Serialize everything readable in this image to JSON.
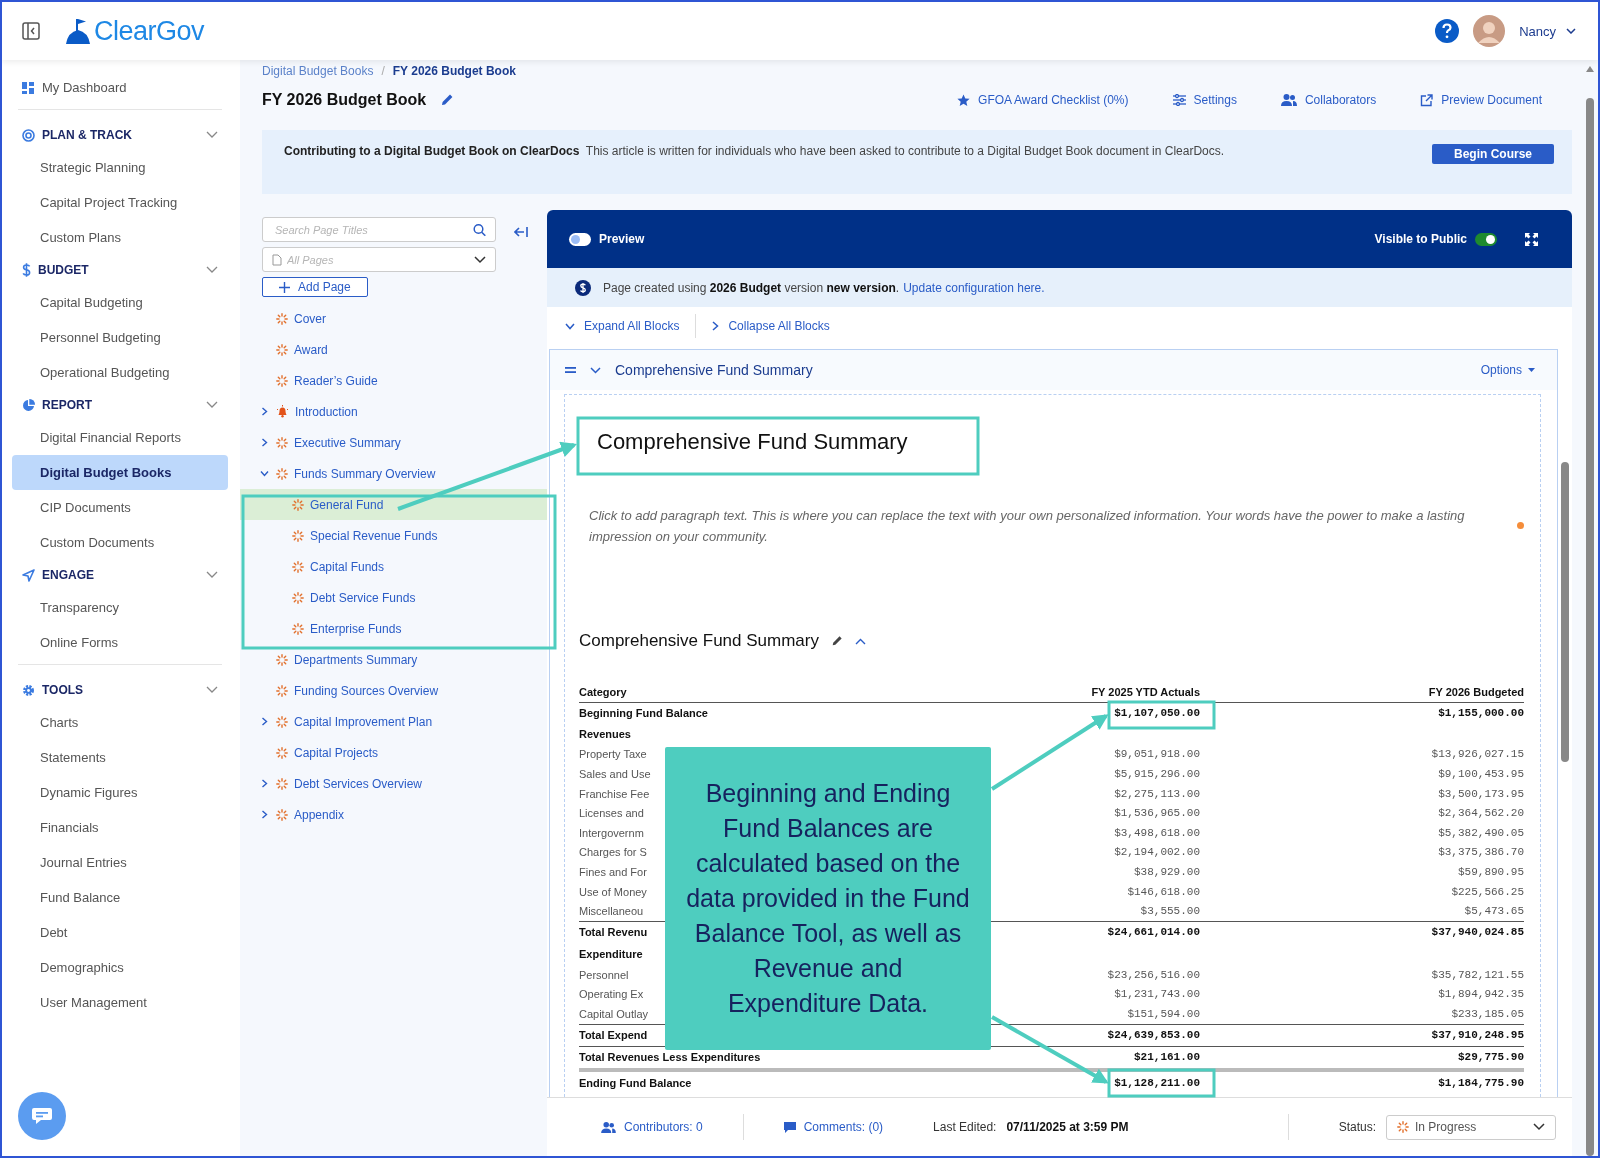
{
  "header": {
    "logo": "ClearGov",
    "user": "Nancy"
  },
  "sidebar": {
    "dashboard": "My Dashboard",
    "groups": [
      {
        "sections": [
          {
            "title": "PLAN & TRACK",
            "kind": "plan",
            "expanded": true,
            "items": [
              {
                "label": "Strategic Planning",
                "selected": false
              },
              {
                "label": "Capital Project Tracking",
                "selected": false
              },
              {
                "label": "Custom Plans",
                "selected": false
              }
            ]
          },
          {
            "title": "BUDGET",
            "kind": "budget",
            "expanded": true,
            "items": [
              {
                "label": "Capital Budgeting",
                "selected": false
              },
              {
                "label": "Personnel Budgeting",
                "selected": false
              },
              {
                "label": "Operational Budgeting",
                "selected": false
              }
            ]
          },
          {
            "title": "REPORT",
            "kind": "report",
            "expanded": true,
            "items": [
              {
                "label": "Digital Financial Reports",
                "selected": false
              },
              {
                "label": "Digital Budget Books",
                "selected": true
              },
              {
                "label": "CIP Documents",
                "selected": false
              },
              {
                "label": "Custom Documents",
                "selected": false
              }
            ]
          },
          {
            "title": "ENGAGE",
            "kind": "engage",
            "expanded": true,
            "items": [
              {
                "label": "Transparency",
                "selected": false
              },
              {
                "label": "Online Forms",
                "selected": false
              }
            ]
          }
        ]
      },
      {
        "sections": [
          {
            "title": "TOOLS",
            "kind": "tools",
            "expanded": true,
            "items": [
              {
                "label": "Charts",
                "selected": false
              },
              {
                "label": "Statements",
                "selected": false
              },
              {
                "label": "Dynamic Figures",
                "selected": false
              },
              {
                "label": "Financials",
                "selected": false
              },
              {
                "label": "Journal Entries",
                "selected": false
              },
              {
                "label": "Fund Balance",
                "selected": false
              },
              {
                "label": "Debt",
                "selected": false
              },
              {
                "label": "Demographics",
                "selected": false
              },
              {
                "label": "User Management",
                "selected": false
              }
            ]
          }
        ]
      }
    ]
  },
  "breadcrumb": {
    "items": [
      "Digital Budget Books",
      "FY 2026 Budget Book"
    ],
    "separator": "/"
  },
  "title": "FY 2026 Budget Book",
  "actions": [
    {
      "label": "GFOA Award Checklist (0%)",
      "kind": "star"
    },
    {
      "label": "Settings",
      "kind": "sliders"
    },
    {
      "label": "Collaborators",
      "kind": "people"
    },
    {
      "label": "Preview Document",
      "kind": "external"
    }
  ],
  "banner": {
    "title": "Contributing to a Digital Budget Book on ClearDocs",
    "text": "This article is written for individuals who have been asked to contribute to a Digital Budget Book document in ClearDocs.",
    "button": "Begin Course"
  },
  "pages": {
    "search": {
      "placeholder": "Search Page Titles"
    },
    "filter": {
      "placeholder": "All Pages"
    },
    "add_button": "Add Page",
    "items": [
      {
        "label": "Cover",
        "alert": false,
        "selected": false
      },
      {
        "label": "Award",
        "alert": false,
        "selected": false
      },
      {
        "label": "Reader’s Guide",
        "alert": false,
        "selected": false
      },
      {
        "label": "Introduction",
        "alert": true,
        "expanded": false,
        "selected": false
      },
      {
        "label": "Executive Summary",
        "alert": false,
        "expanded": false,
        "selected": false
      },
      {
        "label": "Funds Summary Overview",
        "alert": false,
        "expanded": true,
        "selected": false,
        "children": [
          {
            "label": "General Fund",
            "alert": false,
            "selected": true
          },
          {
            "label": "Special Revenue Funds",
            "alert": false,
            "selected": false
          },
          {
            "label": "Capital Funds",
            "alert": false,
            "selected": false
          },
          {
            "label": "Debt Service Funds",
            "alert": false,
            "selected": false
          },
          {
            "label": "Enterprise Funds",
            "alert": false,
            "selected": false
          }
        ]
      },
      {
        "label": "Departments Summary",
        "alert": false,
        "selected": false
      },
      {
        "label": "Funding Sources Overview",
        "alert": false,
        "selected": false
      },
      {
        "label": "Capital Improvement Plan",
        "alert": false,
        "expanded": false,
        "selected": false
      },
      {
        "label": "Capital Projects",
        "alert": false,
        "selected": false
      },
      {
        "label": "Debt Services Overview",
        "alert": false,
        "expanded": false,
        "selected": false
      },
      {
        "label": "Appendix",
        "alert": false,
        "expanded": false,
        "selected": false
      }
    ]
  },
  "editor": {
    "preview": {
      "label": "Preview",
      "on": false
    },
    "visible": {
      "label": "Visible to Public",
      "on": true
    },
    "info": "Page created using **2026 Budget** version **new version**.",
    "info_link": "Update configuration here.",
    "expand_all": "Expand All Blocks",
    "collapse_all": "Collapse All Blocks",
    "block": {
      "title": "Comprehensive Fund Summary",
      "options": "Options",
      "heading": "Comprehensive Fund Summary",
      "paragraph": "Click to add paragraph text. This is where you can replace the text with your own personalized information. Your words have the power to make a lasting impression on your community.",
      "table_title": "Comprehensive Fund Summary",
      "table": {
        "columns": [
          "Category",
          "FY 2025 YTD Actuals",
          "FY 2026 Budgeted"
        ],
        "rows": [
          {
            "kind": "balance",
            "cells": [
              "Beginning Fund Balance",
              "$1,107,050.00",
              "$1,155,000.00"
            ]
          },
          {
            "kind": "section",
            "cells": [
              "Revenues"
            ]
          },
          {
            "kind": "line",
            "cells": [
              "Property Taxe",
              "$9,051,918.00",
              "$13,926,027.15"
            ]
          },
          {
            "kind": "line",
            "cells": [
              "Sales and Use",
              "$5,915,296.00",
              "$9,100,453.95"
            ]
          },
          {
            "kind": "line",
            "cells": [
              "Franchise Fee",
              "$2,275,113.00",
              "$3,500,173.95"
            ]
          },
          {
            "kind": "line",
            "cells": [
              "Licenses and",
              "$1,536,965.00",
              "$2,364,562.20"
            ]
          },
          {
            "kind": "line",
            "cells": [
              "Intergovernm",
              "$3,498,618.00",
              "$5,382,490.05"
            ]
          },
          {
            "kind": "line",
            "cells": [
              "Charges for S",
              "$2,194,002.00",
              "$3,375,386.70"
            ]
          },
          {
            "kind": "line",
            "cells": [
              "Fines and For",
              "$38,929.00",
              "$59,890.95"
            ]
          },
          {
            "kind": "line",
            "cells": [
              "Use of Money",
              "$146,618.00",
              "$225,566.25"
            ]
          },
          {
            "kind": "line",
            "cells": [
              "Miscellaneou",
              "$3,555.00",
              "$5,473.65"
            ]
          },
          {
            "kind": "total",
            "cells": [
              "Total Revenu",
              "$24,661,014.00",
              "$37,940,024.85"
            ]
          },
          {
            "kind": "section",
            "cells": [
              "Expenditure"
            ]
          },
          {
            "kind": "line",
            "cells": [
              "Personnel",
              "$23,256,516.00",
              "$35,782,121.55"
            ]
          },
          {
            "kind": "line",
            "cells": [
              "Operating Ex",
              "$1,231,743.00",
              "$1,894,942.35"
            ]
          },
          {
            "kind": "line",
            "cells": [
              "Capital Outlay",
              "$151,594.00",
              "$233,185.05"
            ]
          },
          {
            "kind": "total",
            "cells": [
              "Total Expend",
              "$24,639,853.00",
              "$37,910,248.95"
            ]
          },
          {
            "kind": "total",
            "cells": [
              "Total Revenues Less Expenditures",
              "$21,161.00",
              "$29,775.90"
            ]
          },
          {
            "kind": "ending",
            "cells": [
              "Ending Fund Balance",
              "$1,128,211.00",
              "$1,184,775.90"
            ]
          }
        ]
      }
    },
    "footer": {
      "contributors": "Contributors: 0",
      "comments": "Comments: (0)",
      "edited_label": "Last Edited:",
      "edited_value": "07/11/2025 at 3:59 PM",
      "status_label": "Status:",
      "status_value": "In Progress"
    }
  },
  "callout": "Beginning and Ending Fund Balances are calculated based on the data provided in the Fund Balance Tool, as well as Revenue and Expenditure Data."
}
